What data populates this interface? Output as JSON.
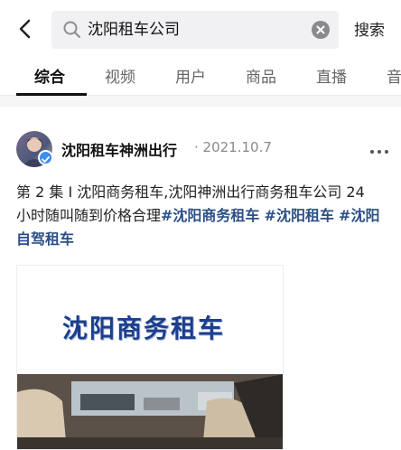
{
  "search": {
    "query": "沈阳租车公司",
    "button_label": "搜索"
  },
  "tabs": [
    {
      "label": "综合",
      "active": true
    },
    {
      "label": "视频",
      "active": false
    },
    {
      "label": "用户",
      "active": false
    },
    {
      "label": "商品",
      "active": false
    },
    {
      "label": "直播",
      "active": false
    },
    {
      "label": "音",
      "active": false
    }
  ],
  "post": {
    "author": "沈阳租车神洲出行",
    "date": "· 2021.10.7",
    "text_plain": "第 2 集 I 沈阳商务租车,沈阳神洲出行商务租车公司 24 小时随叫随到价格合理",
    "tags": [
      "#沈阳商务租车",
      "#沈阳租车",
      "#沈阳自驾租车"
    ],
    "media_banner": "沈阳商务租车"
  },
  "colors": {
    "tag": "#2c4f86",
    "badge": "#3d8cf0",
    "banner_text": "#1c3e8c"
  },
  "icons": {
    "back": "chevron-left-icon",
    "search": "search-icon",
    "clear": "clear-icon",
    "more": "more-icon",
    "verified": "verified-badge-icon"
  }
}
